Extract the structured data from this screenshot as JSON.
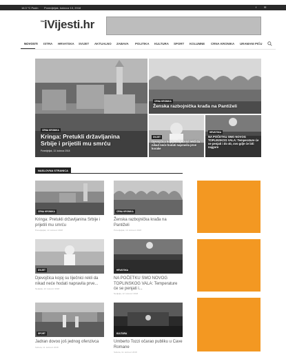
{
  "topbar": {
    "weather": "16.3 °C Pazin",
    "date": "Ponedjeljak, kolovoz 13, 2018",
    "social": [
      "f",
      "✉"
    ]
  },
  "site": {
    "logo_prefix": "Novi",
    "logo_text": "iVijesti.hr"
  },
  "nav": {
    "items": [
      "Novosti",
      "Istra",
      "Hrvatska",
      "Svijet",
      "Aktualno",
      "Zabava",
      "Politika",
      "Kultura",
      "Sport",
      "Kolumne",
      "Crna kronika",
      "Uramani piću"
    ],
    "active": "Novosti"
  },
  "hero": {
    "main": {
      "category": "Crna kronika",
      "title": "Kringa: Pretukli državljanina Srbije i prijetili mu smrću",
      "date": "Ponedjeljak, 13. kolovoz 2018"
    },
    "top_right": {
      "category": "Crna kronika",
      "title": "Ženska razbojnička krađa na Pantiželi"
    },
    "bottom_left": {
      "category": "Svijet",
      "title": "Djevojčica kojoj su liječnici rekli da nikad neće hodati napravila prve korake"
    },
    "bottom_right": {
      "category": "Hrvatska",
      "title": "NA POČETKU SMO NOVOG TOPLINSKOG VALA: Temperature će se penjati i do 40, ovo gdje će biti najgore"
    }
  },
  "section": {
    "label": "Naslovna stranica"
  },
  "cards": [
    {
      "category": "Crna kronika",
      "title": "Kringa: Pretukli državljanina Srbije i prijetili mu smrću",
      "date": "Ponedjeljak, 13. kolovoz 2018"
    },
    {
      "category": "Crna kronika",
      "title": "Ženska razbojnička krađa na Pantiželi",
      "date": "Ponedjeljak, 13. kolovoz 2018"
    },
    {
      "category": "Svijet",
      "title": "Djevojčica kojoj su liječnici rekli da nikad neće hodati napravila prve...",
      "date": "Nedjelja, 12. kolovoz 2018"
    },
    {
      "category": "Hrvatska",
      "title": "NA POČETKU SMO NOVOG TOPLINSKOG VALA: Temperature će se penjati i...",
      "date": "Nedjelja, 12. kolovoz 2018"
    },
    {
      "category": "Sport",
      "title": "Jadran dovoo još jednog ofenzivca",
      "date": "Subota, 11. kolovoz 2018"
    },
    {
      "category": "Kultura",
      "title": "Umberto Tozzi očarao publiku u Cave Romane",
      "date": "Subota, 11. kolovoz 2018"
    }
  ],
  "colors": {
    "ad": "#f39822",
    "nav_active": "#222222",
    "badge": "#222222"
  }
}
